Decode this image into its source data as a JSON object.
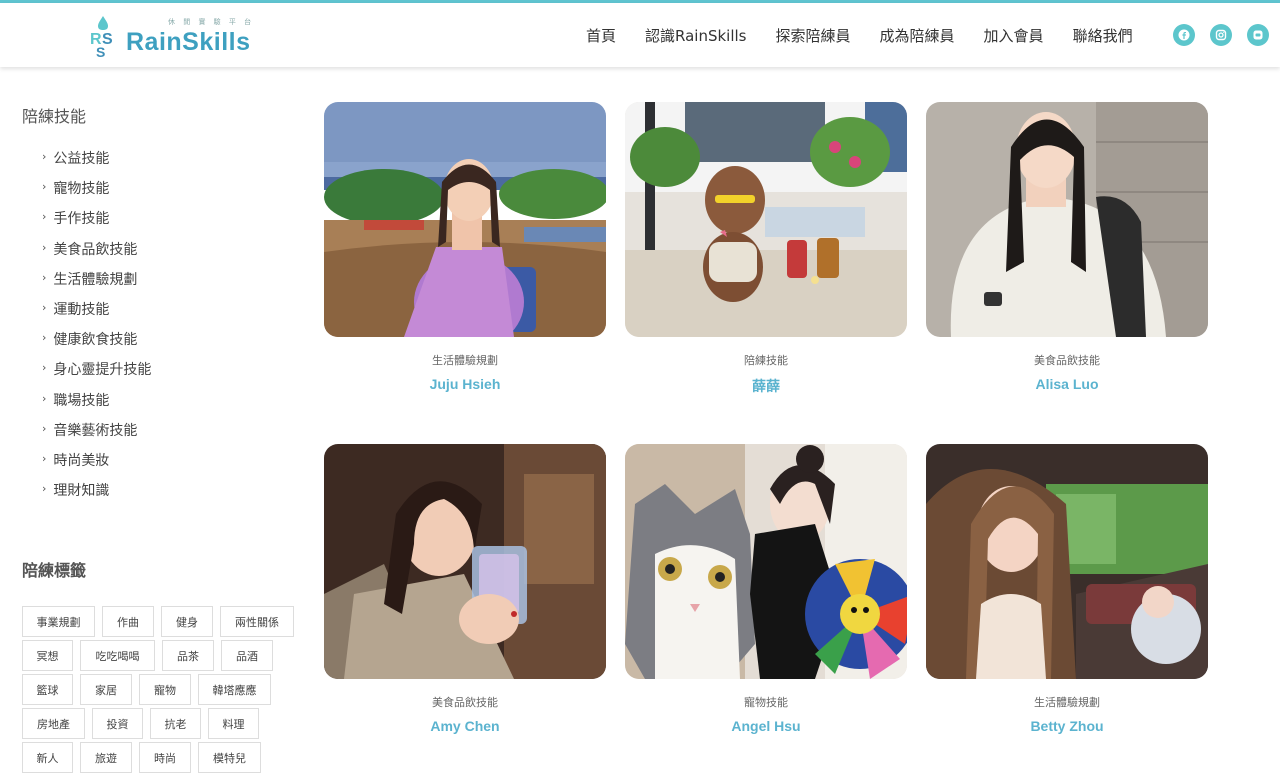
{
  "brand": {
    "name": "RainSkills",
    "tagline": "休 閒 實 驗 平 台"
  },
  "nav": [
    "首頁",
    "認識RainSkills",
    "探索陪練員",
    "成為陪練員",
    "加入會員",
    "聯絡我們"
  ],
  "social": [
    "facebook-icon",
    "instagram-icon",
    "line-icon"
  ],
  "sidebar": {
    "title": "陪練技能",
    "categories": [
      "公益技能",
      "寵物技能",
      "手作技能",
      "美食品飲技能",
      "生活體驗規劃",
      "運動技能",
      "健康飲食技能",
      "身心靈提升技能",
      "職場技能",
      "音樂藝術技能",
      "時尚美妝",
      "理財知識"
    ]
  },
  "tags": {
    "title": "陪練標籤",
    "rows": [
      [
        "事業規劃",
        "作曲",
        "健身",
        "兩性關係"
      ],
      [
        "冥想",
        "吃吃喝喝",
        "品茶",
        "品酒"
      ],
      [
        "籃球",
        "家居",
        "寵物",
        "韓塔應應"
      ],
      [
        "房地產",
        "投資",
        "抗老",
        "料理"
      ],
      [
        "新人",
        "旅遊",
        "時尚",
        "模特兒"
      ]
    ]
  },
  "trainers": [
    {
      "category": "生活體驗規劃",
      "name": "Juju Hsieh",
      "photo": "woman-seaside-photo"
    },
    {
      "category": "陪練技能",
      "name": "薛薛",
      "photo": "poodle-dog-photo"
    },
    {
      "category": "美食品飲技能",
      "name": "Alisa Luo",
      "photo": "woman-white-hoodie-photo"
    },
    {
      "category": "美食品飲技能",
      "name": "Amy Chen",
      "photo": "woman-with-glass-photo"
    },
    {
      "category": "寵物技能",
      "name": "Angel Hsu",
      "photo": "woman-with-cat-photo"
    },
    {
      "category": "生活體驗規劃",
      "name": "Betty Zhou",
      "photo": "woman-in-car-photo"
    }
  ],
  "colors": {
    "accent": "#5bb3cf",
    "teal": "#5cc6cc"
  }
}
